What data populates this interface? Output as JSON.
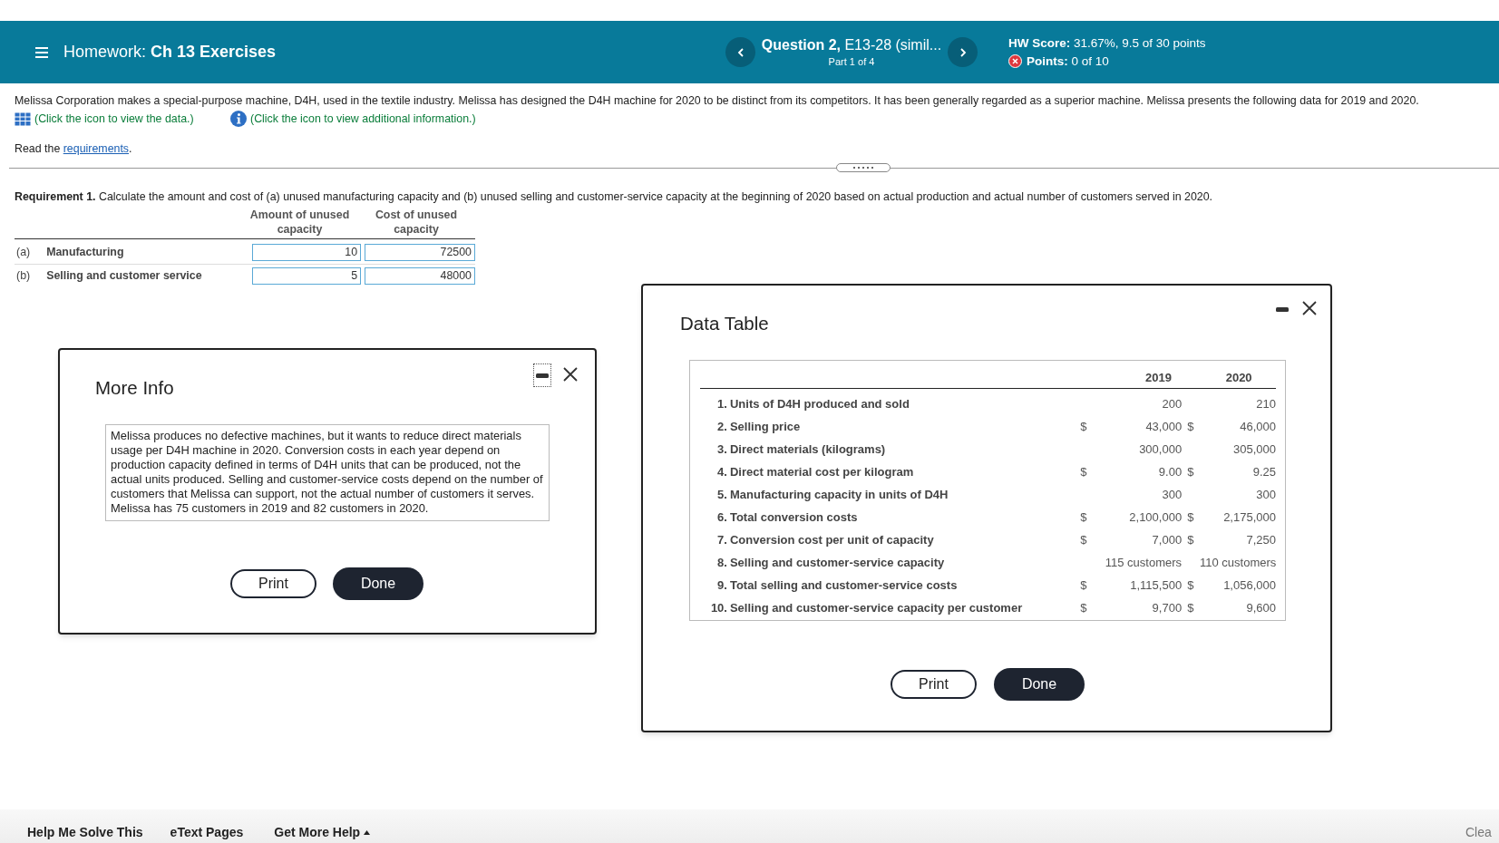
{
  "header": {
    "title": "Homework: **Ch 13 Exercises**",
    "question": "**Question 2,** E13-28 (simil...",
    "part": "Part 1 of 4",
    "score": "**HW Score:** 31.67%, 9.5 of 30 points",
    "points": "**Points:** 0 of 10"
  },
  "problem": {
    "text": "Melissa Corporation makes a special-purpose machine, D4H, used in the textile industry. Melissa has designed the D4H machine for 2020 to be distinct from its competitors. It has been generally regarded as a superior machine. Melissa presents the following data for 2019 and 2020.",
    "data_link": "(Click the icon to view the data.)",
    "info_link": "(Click the icon to view additional information.)",
    "read_prefix": "Read the",
    "requirements_link": "requirements",
    "read_suffix": "."
  },
  "requirement": {
    "text": "**Requirement 1.** Calculate the amount and cost of (a) unused manufacturing capacity and (b) unused selling and customer-service capacity at the beginning of 2020 based on actual production and actual number of customers served in 2020.",
    "columns": [
      "Amount of unused capacity",
      "Cost of unused capacity"
    ],
    "rows": [
      {
        "marker": "(a)",
        "label": "Manufacturing",
        "amount": "10",
        "cost": "72500"
      },
      {
        "marker": "(b)",
        "label": "Selling and customer service",
        "amount": "5",
        "cost": "48000"
      }
    ]
  },
  "more_info": {
    "title": "More Info",
    "text": "Melissa produces no defective machines, but it wants to reduce direct materials usage per D4H machine in 2020. Conversion costs in each year depend on production capacity defined in terms of D4H units that can be produced, not the actual units produced. Selling and customer-service costs depend on the number of customers that Melissa can support, not the actual number of customers it serves. Melissa has 75 customers in 2019 and 82 customers in 2020.",
    "buttons": [
      "Print",
      "Done"
    ]
  },
  "data_table": {
    "title": "Data Table",
    "columns": [
      "2019",
      "2020"
    ],
    "rows": [
      {
        "number": "1.",
        "label": "Units of D4H produced and sold",
        "value_2019": "200",
        "value_2020": "210"
      },
      {
        "number": "2.",
        "label": "Selling price",
        "currency_2019": "$",
        "value_2019": "43,000",
        "currency_2020": "$",
        "value_2020": "46,000"
      },
      {
        "number": "3.",
        "label": "Direct materials (kilograms)",
        "value_2019": "300,000",
        "value_2020": "305,000"
      },
      {
        "number": "4.",
        "label": "Direct material cost per kilogram",
        "currency_2019": "$",
        "value_2019": "9.00",
        "currency_2020": "$",
        "value_2020": "9.25"
      },
      {
        "number": "5.",
        "label": "Manufacturing capacity in units of D4H",
        "value_2019": "300",
        "value_2020": "300"
      },
      {
        "number": "6.",
        "label": "Total conversion costs",
        "currency_2019": "$",
        "value_2019": "2,100,000",
        "currency_2020": "$",
        "value_2020": "2,175,000"
      },
      {
        "number": "7.",
        "label": "Conversion cost per unit of capacity",
        "currency_2019": "$",
        "value_2019": "7,000",
        "currency_2020": "$",
        "value_2020": "7,250"
      },
      {
        "number": "8.",
        "label": "Selling and customer-service capacity",
        "value_2019": "115 customers",
        "value_2020": "110 customers"
      },
      {
        "number": "9.",
        "label": "Total selling and customer-service costs",
        "currency_2019": "$",
        "value_2019": "1,115,500",
        "currency_2020": "$",
        "value_2020": "1,056,000"
      },
      {
        "number": "10.",
        "label": "Selling and customer-service capacity per customer",
        "currency_2019": "$",
        "value_2019": "9,700",
        "currency_2020": "$",
        "value_2020": "9,600"
      }
    ],
    "buttons": [
      "Print",
      "Done"
    ]
  },
  "footer": {
    "links": [
      "Help Me Solve This",
      "eText Pages",
      "Get More Help"
    ],
    "right": "Clea"
  }
}
